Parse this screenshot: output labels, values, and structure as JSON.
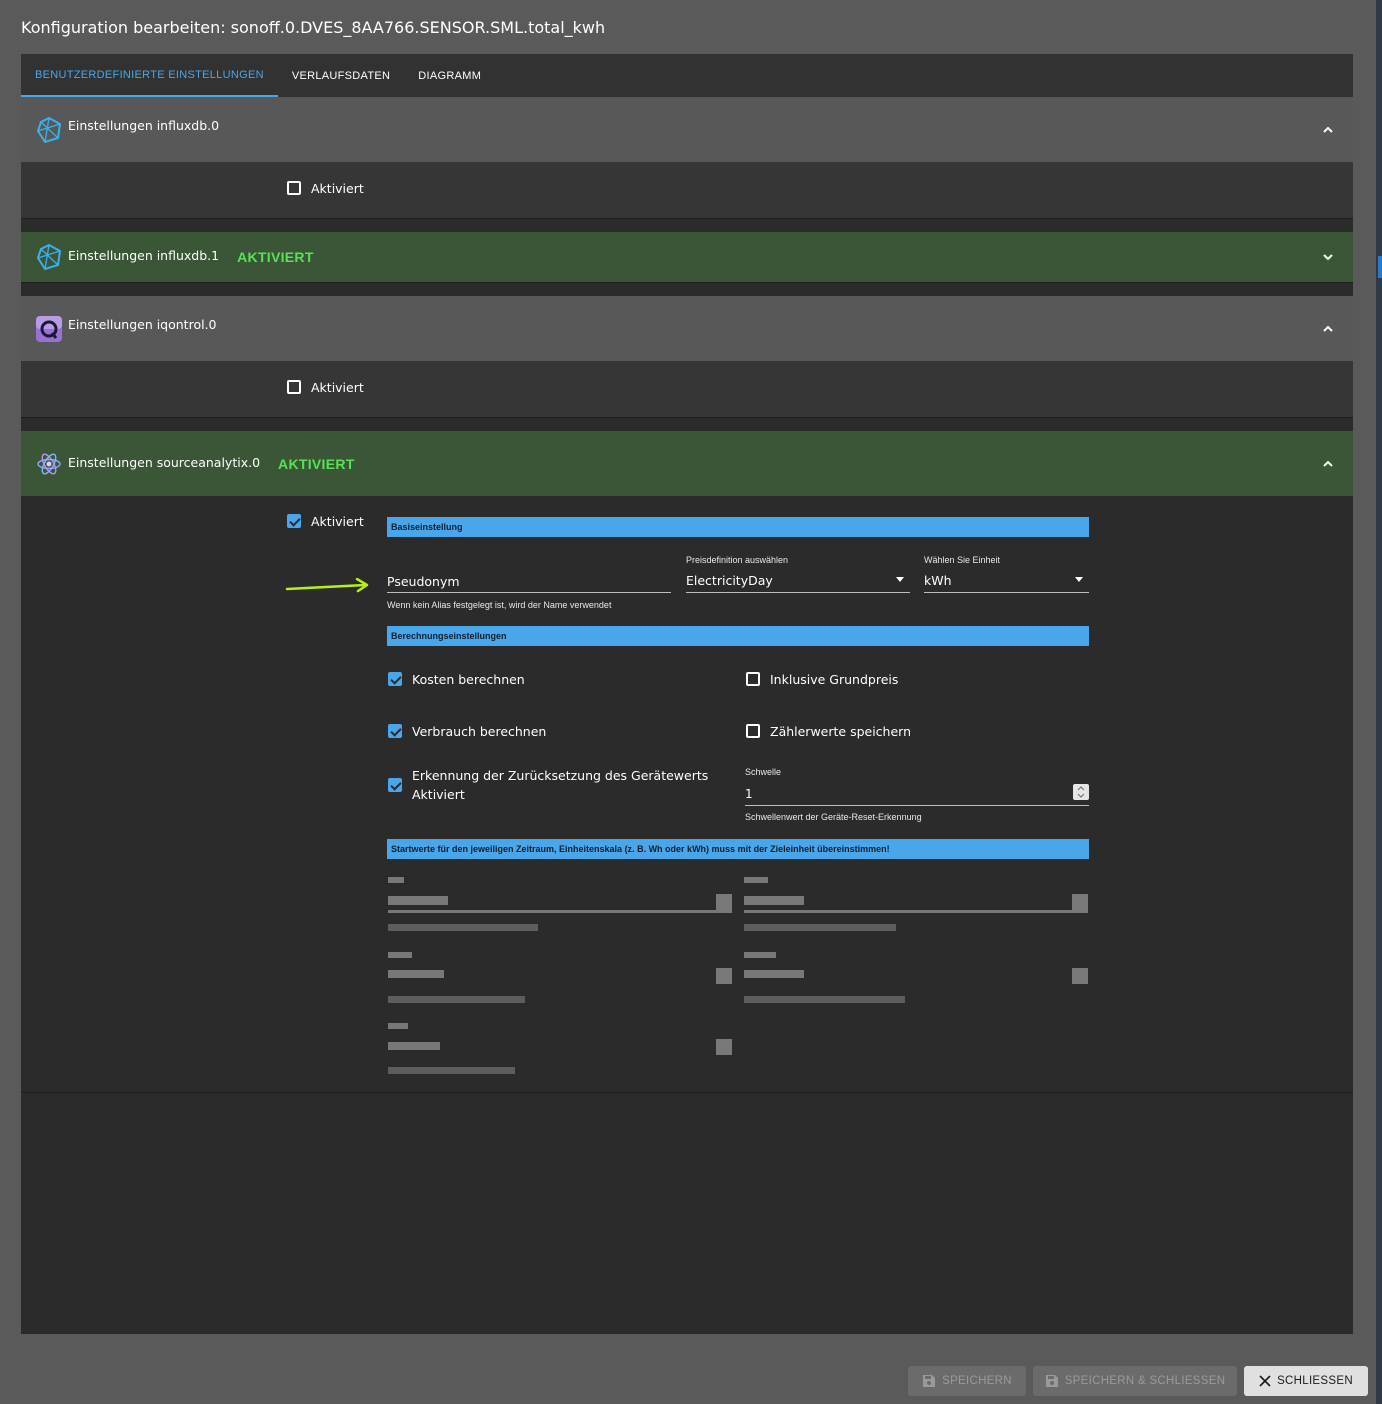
{
  "dialog": {
    "title": "Konfiguration bearbeiten: sonoff.0.DVES_8AA766.SENSOR.SML.total_kwh"
  },
  "tabs": [
    {
      "label": "BENUTZERDEFINIERTE EINSTELLUNGEN",
      "active": true
    },
    {
      "label": "VERLAUFSDATEN",
      "active": false
    },
    {
      "label": "DIAGRAMM",
      "active": false
    }
  ],
  "accordions": {
    "influxdb0": {
      "title": "Einstellungen influxdb.0",
      "checkbox_label": "Aktiviert",
      "checked": false,
      "expanded": true
    },
    "influxdb1": {
      "title": "Einstellungen influxdb.1",
      "badge": "AKTIVIERT",
      "expanded": false
    },
    "iqontrol0": {
      "title": "Einstellungen iqontrol.0",
      "checkbox_label": "Aktiviert",
      "checked": false,
      "expanded": true
    },
    "sourceanalytix0": {
      "title": "Einstellungen sourceanalytix.0",
      "badge": "AKTIVIERT",
      "checkbox_label": "Aktiviert",
      "checked": true,
      "expanded": true
    }
  },
  "sourceanalytix": {
    "basic_section": "Basiseinstellung",
    "alias": {
      "value": "Pseudonym",
      "helper": "Wenn kein Alias festgelegt ist, wird der Name verwendet"
    },
    "price_definition": {
      "label": "Preisdefinition auswählen",
      "value": "ElectricityDay"
    },
    "unit": {
      "label": "Wählen Sie Einheit",
      "value": "kWh"
    },
    "calc_section": "Berechnungseinstellungen",
    "options": {
      "calc_costs": {
        "label": "Kosten berechnen",
        "checked": true
      },
      "incl_base_price": {
        "label": "Inklusive Grundpreis",
        "checked": false
      },
      "calc_consumption": {
        "label": "Verbrauch berechnen",
        "checked": true
      },
      "save_meter_values": {
        "label": "Zählerwerte speichern",
        "checked": false
      },
      "reset_detection": {
        "label_line1": "Erkennung der Zurücksetzung des Gerätewerts",
        "label_line2": "Aktiviert",
        "checked": true
      }
    },
    "threshold": {
      "label": "Schwelle",
      "value": "1",
      "helper": "Schwellenwert der Geräte-Reset-Erkennung"
    },
    "start_section": "Startwerte für den jeweiligen Zeitraum, Einheitenskala (z. B. Wh oder kWh) muss mit der Zieleinheit übereinstimmen!"
  },
  "footer": {
    "save": "SPEICHERN",
    "save_close": "SPEICHERN & SCHLIESSEN",
    "close": "SCHLIESSEN"
  },
  "colors": {
    "accent": "#4aa6ea",
    "active_green": "#55e255",
    "annotation_arrow": "#b6f01a"
  }
}
